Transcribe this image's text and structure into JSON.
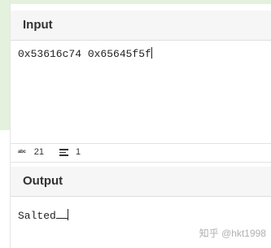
{
  "input": {
    "title": "Input",
    "value": "0x53616c74 0x65645f5f"
  },
  "status": {
    "abc_label": "abc",
    "char_count": "21",
    "line_count": "1"
  },
  "output": {
    "title": "Output",
    "value": "Salted"
  },
  "watermark": "知乎 @hkt1998"
}
